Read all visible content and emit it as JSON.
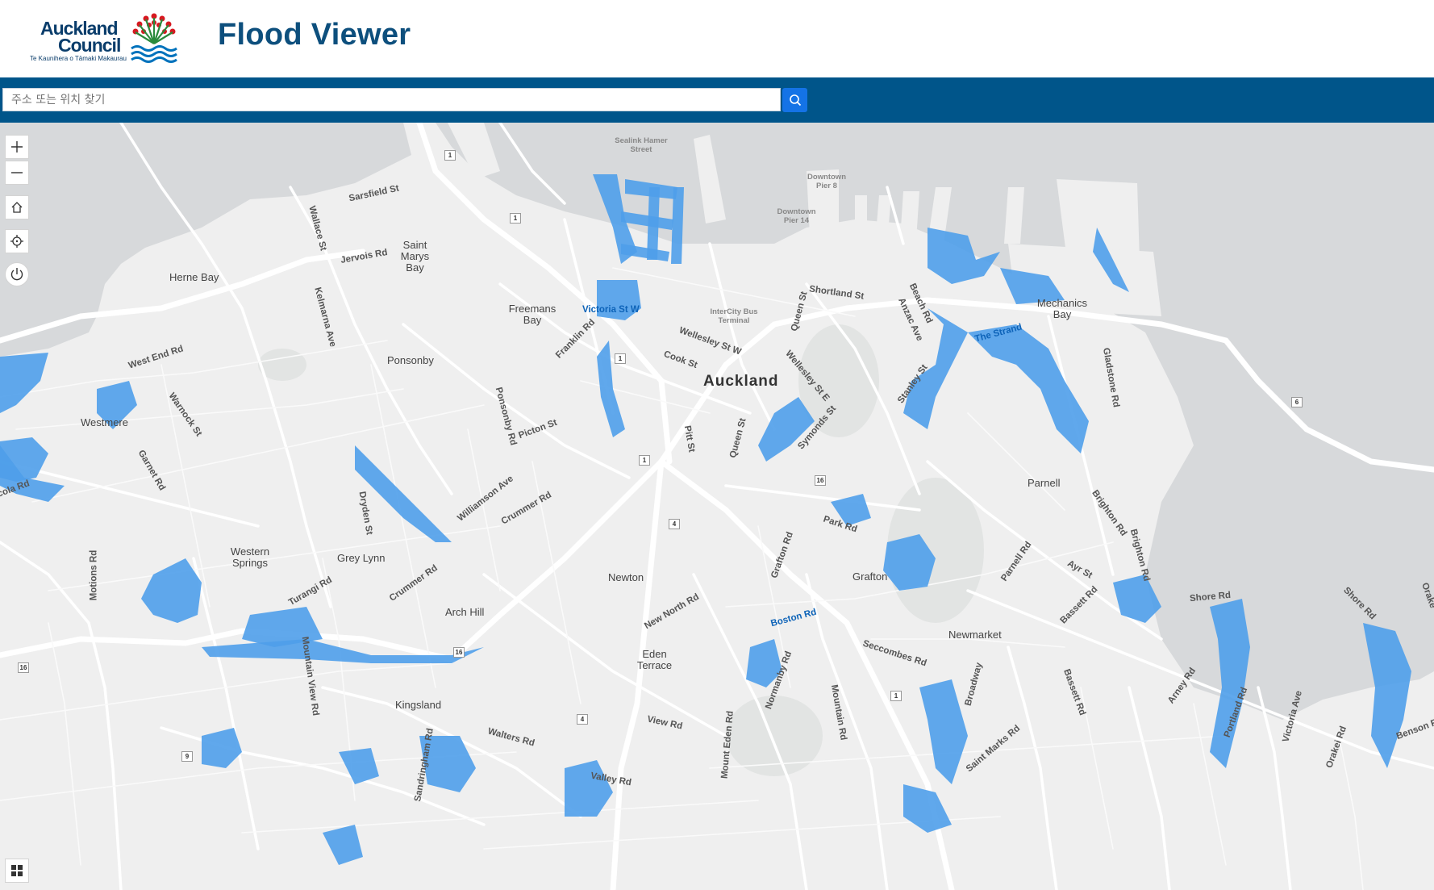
{
  "header": {
    "logo": {
      "line1": "Auckland",
      "line2": "Council",
      "tagline": "Te Kaunihera o Tāmaki Makaurau"
    },
    "title": "Flood Viewer"
  },
  "search": {
    "placeholder": "주소 또는 위치 찾기",
    "button_icon": "search-icon"
  },
  "colors": {
    "header_bar": "#00558a",
    "search_button": "#1473e6",
    "flood": "#4f9eea",
    "land": "#efefef",
    "water": "#d7d9db",
    "road": "#ffffff"
  },
  "map_controls": [
    {
      "name": "zoom-in-button",
      "icon": "plus-icon"
    },
    {
      "name": "zoom-out-button",
      "icon": "minus-icon"
    },
    {
      "name": "home-button",
      "icon": "home-icon"
    },
    {
      "name": "locate-button",
      "icon": "locate-icon"
    },
    {
      "name": "power-button",
      "icon": "power-icon"
    },
    {
      "name": "basemap-gallery-button",
      "icon": "grid-icon"
    }
  ],
  "map": {
    "city": "Auckland",
    "suburbs": {
      "herne_bay": "Herne Bay",
      "saint_marys_bay": "Saint Marys Bay",
      "freemans_bay": "Freemans Bay",
      "ponsonby": "Ponsonby",
      "westmere": "Westmere",
      "western_springs": "Western Springs",
      "grey_lynn": "Grey Lynn",
      "arch_hill": "Arch Hill",
      "newton": "Newton",
      "grafton": "Grafton",
      "newmarket": "Newmarket",
      "eden_terrace": "Eden Terrace",
      "kingsland": "Kingsland",
      "parnell": "Parnell",
      "mechanics_bay": "Mechanics Bay"
    },
    "poi": {
      "sealink": "Sealink Hamer Street",
      "downtown_pier8": "Downtown Pier 8",
      "downtown_pier14": "Downtown Pier 14",
      "intercity": "InterCity Bus Terminal"
    },
    "roads": {
      "sarsfield": "Sarsfield St",
      "wallace": "Wallace St",
      "jervois": "Jervois Rd",
      "kelmarna": "Kelmarna Ave",
      "west_end": "West End Rd",
      "warnock": "Warnock St",
      "garnet": "Garnet Rd",
      "victoria_w": "Victoria St W",
      "franklin": "Franklin Rd",
      "wellesley_w": "Wellesley St W",
      "cook": "Cook St",
      "shortland": "Shortland St",
      "queen_top": "Queen St",
      "beach": "Beach Rd",
      "anzac": "Anzac Ave",
      "the_strand": "The Strand",
      "gladstone": "Gladstone Rd",
      "stanley": "Stanley St",
      "wellesley_e": "Wellesley St E",
      "symonds": "Symonds St",
      "queen_mid": "Queen St",
      "pitt": "Pitt St",
      "picton": "Picton St",
      "ponsonby_rd": "Ponsonby Rd",
      "williamson": "Williamson Ave",
      "crummer1": "Crummer Rd",
      "crummer2": "Crummer Rd",
      "dryden": "Dryden St",
      "motions": "Motions Rd",
      "turangi": "Turangi Rd",
      "mountain_view": "Mountain View Rd",
      "park": "Park Rd",
      "grafton_rd": "Grafton Rd",
      "brighton1": "Brighton Rd",
      "brighton2": "Brighton Rd",
      "parnell_rd": "Parnell Rd",
      "ayr": "Ayr St",
      "bassett1": "Bassett Rd",
      "bassett2": "Bassett Rd",
      "shore1": "Shore Rd",
      "shore2": "Shore Rd",
      "new_north": "New North Rd",
      "boston": "Boston Rd",
      "seccombes": "Seccombes Rd",
      "broadway": "Broadway",
      "normanby": "Normanby Rd",
      "view": "View Rd",
      "mount_eden": "Mount Eden Rd",
      "mountain": "Mountain Rd",
      "walters": "Walters Rd",
      "valley": "Valley Rd",
      "sandringham": "Sandringham Rd",
      "saint_marks": "Saint Marks Rd",
      "arney": "Arney Rd",
      "victoria_ave": "Victoria Ave",
      "orakei": "Orakei Rd",
      "benson": "Benson Rd",
      "portland": "Portland Rd",
      "orakei_edge": "Orake",
      "tamaki": "cola Rd"
    },
    "shields": {
      "s1a": "1",
      "s1b": "1",
      "s1c": "1",
      "s1d": "1",
      "s1e": "1",
      "s4a": "4",
      "s4b": "4",
      "s16a": "16",
      "s16b": "16",
      "s16c": "16",
      "s6": "6",
      "s9": "9"
    }
  }
}
